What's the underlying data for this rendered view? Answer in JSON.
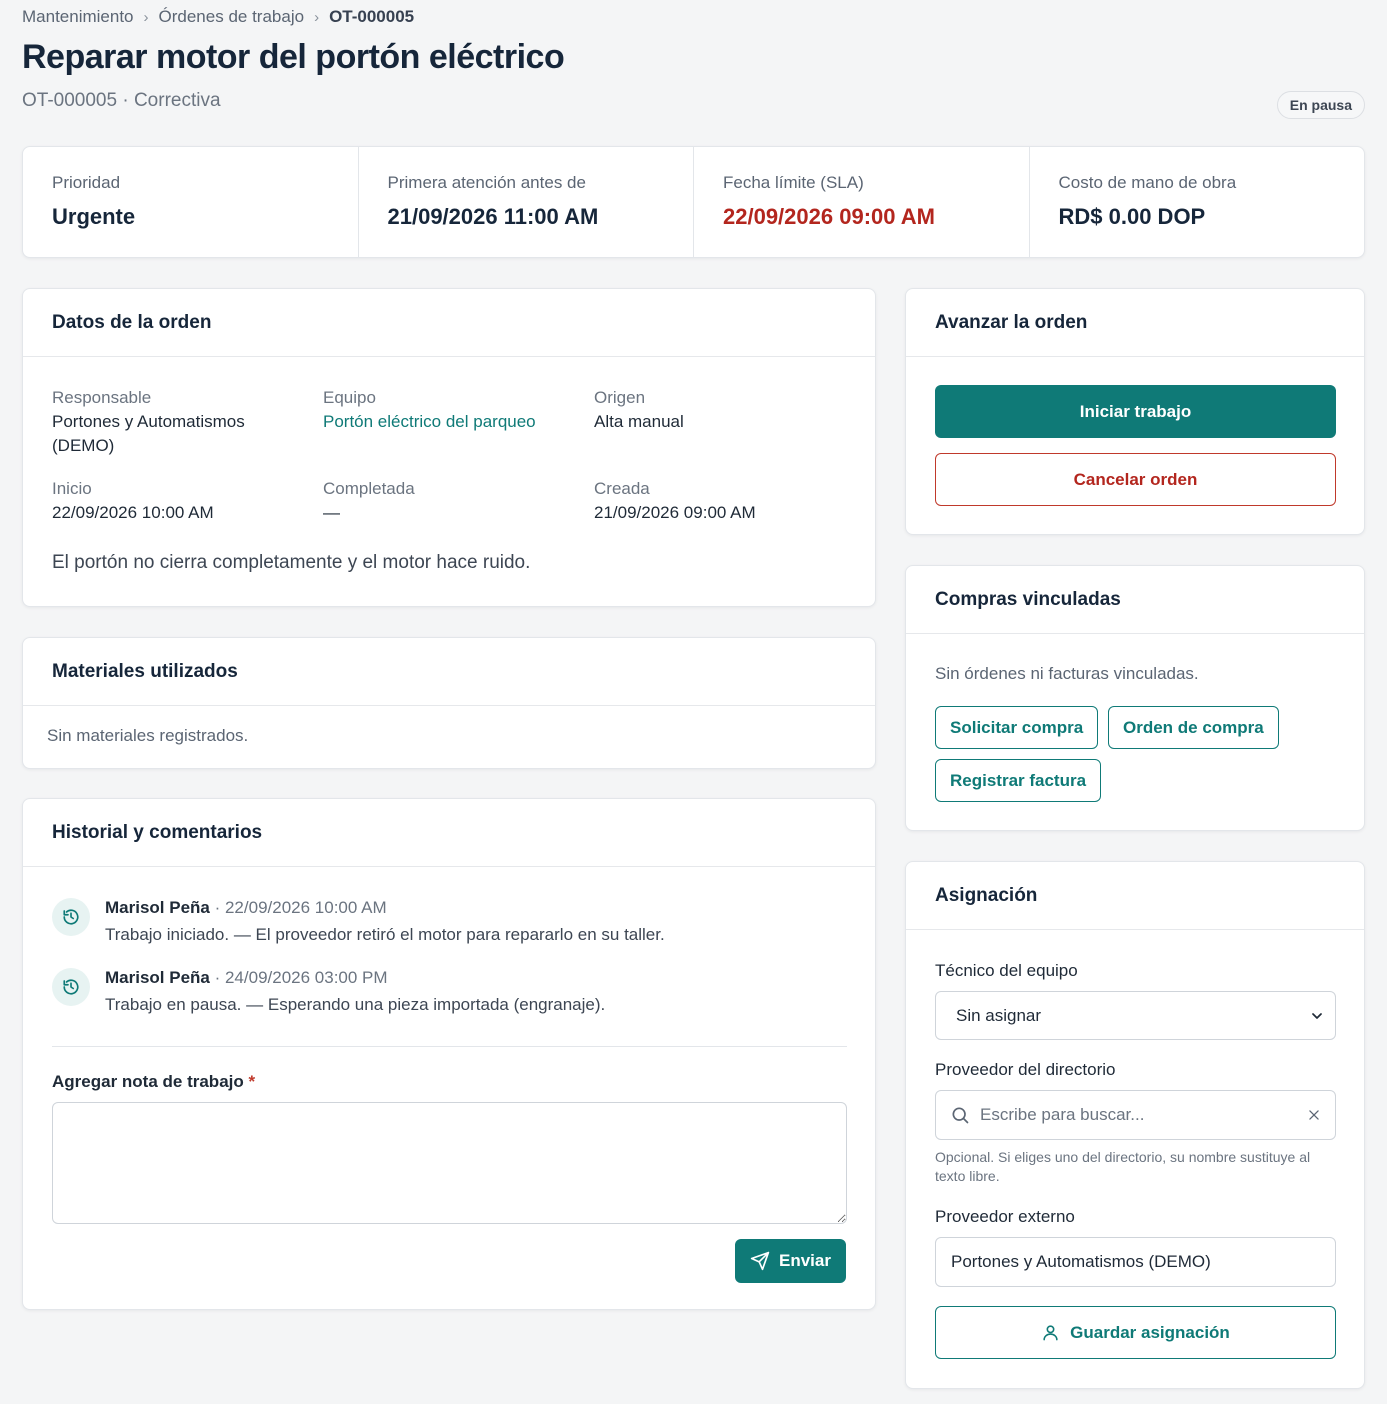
{
  "breadcrumb": {
    "items": [
      "Mantenimiento",
      "Órdenes de trabajo",
      "OT-000005"
    ],
    "separator": "›"
  },
  "header": {
    "title": "Reparar motor del portón eléctrico",
    "subtitle": "OT-000005 · Correctiva",
    "status": "En pausa"
  },
  "stats": [
    {
      "label": "Prioridad",
      "value": "Urgente"
    },
    {
      "label": "Primera atención antes de",
      "value": "21/09/2026 11:00 AM"
    },
    {
      "label": "Fecha límite (SLA)",
      "value": "22/09/2026 09:00 AM",
      "color": "#b3261e"
    },
    {
      "label": "Costo de mano de obra",
      "value": "RD$ 0.00 DOP"
    }
  ],
  "datos": {
    "title": "Datos de la orden",
    "responsable_label": "Responsable",
    "responsable_value_1": "Portones y Automatismos",
    "responsable_value_2": "(DEMO)",
    "equipo_label": "Equipo",
    "equipo_value": "Portón eléctrico del parqueo",
    "origen_label": "Origen",
    "origen_value": "Alta manual",
    "inicio_label": "Inicio",
    "inicio_value": "22/09/2026 10:00 AM",
    "completada_label": "Completada",
    "completada_value": "—",
    "creada_label": "Creada",
    "creada_value": "21/09/2026 09:00 AM",
    "description": "El portón no cierra completamente y el motor hace ruido."
  },
  "materiales": {
    "title": "Materiales utilizados",
    "empty": "Sin materiales registrados."
  },
  "historial": {
    "title": "Historial y comentarios",
    "entries": [
      {
        "author": "Marisol Peña",
        "date": " · 22/09/2026 10:00 AM",
        "text": "Trabajo iniciado. — El proveedor retiró el motor para repararlo en su taller."
      },
      {
        "author": "Marisol Peña",
        "date": " · 24/09/2026 03:00 PM",
        "text": "Trabajo en pausa. — Esperando una pieza importada (engranaje)."
      }
    ],
    "note_label": "Agregar nota de trabajo",
    "required_mark": "*",
    "note_value": "",
    "send_label": "Enviar"
  },
  "avanzar": {
    "title": "Avanzar la orden",
    "start_label": "Iniciar trabajo",
    "cancel_label": "Cancelar orden"
  },
  "compras": {
    "title": "Compras vinculadas",
    "empty": "Sin órdenes ni facturas vinculadas.",
    "request_label": "Solicitar compra",
    "po_label": "Orden de compra",
    "invoice_label": "Registrar factura"
  },
  "asignacion": {
    "title": "Asignación",
    "tecnico_label": "Técnico del equipo",
    "tecnico_value": "Sin asignar",
    "proveedor_dir_label": "Proveedor del directorio",
    "search_placeholder": "Escribe para buscar...",
    "helper": "Opcional. Si eliges uno del directorio, su nombre sustituye al texto libre.",
    "proveedor_ext_label": "Proveedor externo",
    "proveedor_ext_value": "Portones y Automatismos (DEMO)",
    "save_label": "Guardar asignación"
  },
  "colors": {
    "accent": "#0f7a77",
    "danger": "#b3261e",
    "background": "#f4f5f6"
  },
  "icons": [
    "chevron-right-icon",
    "history-icon",
    "send-icon",
    "search-icon",
    "close-icon",
    "chevron-down-icon",
    "user-icon"
  ]
}
